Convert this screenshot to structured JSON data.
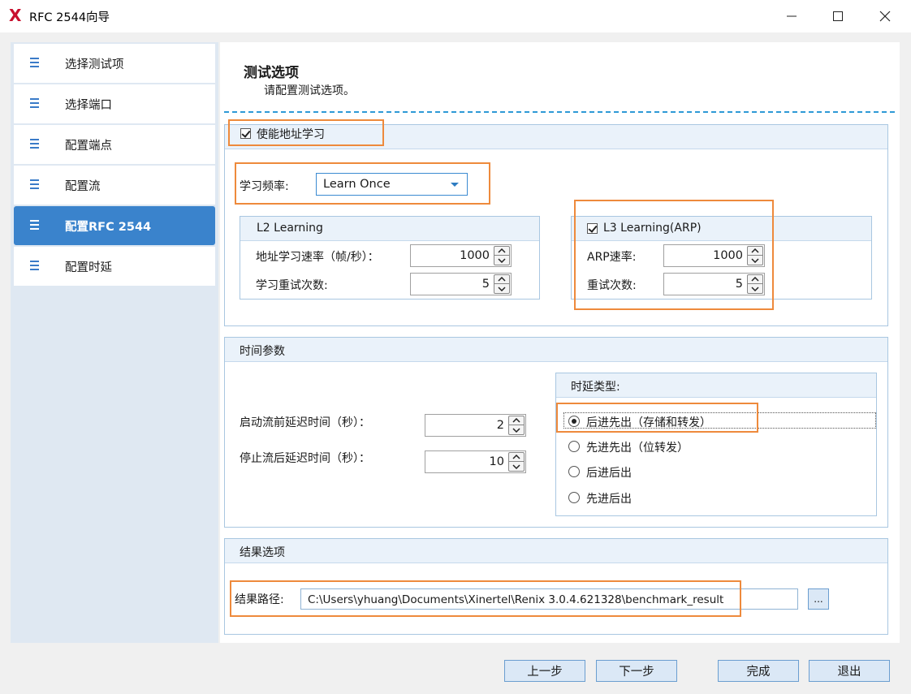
{
  "window": {
    "logo_letter": "X",
    "title": "RFC 2544向导"
  },
  "sidebar": {
    "items": [
      {
        "label": "选择测试项"
      },
      {
        "label": "选择端口"
      },
      {
        "label": "配置端点"
      },
      {
        "label": "配置流"
      },
      {
        "label": "配置RFC 2544",
        "active": true
      },
      {
        "label": "配置时延"
      }
    ]
  },
  "header": {
    "title": "测试选项",
    "subtitle": "请配置测试选项。"
  },
  "address_learning": {
    "enable_label": "使能地址学习",
    "enabled": true,
    "frequency_label": "学习频率:",
    "frequency_value": "Learn Once",
    "l2": {
      "title": "L2 Learning",
      "rate_label": "地址学习速率（帧/秒）：",
      "rate_value": "1000",
      "retry_label": "学习重试次数:",
      "retry_value": "5"
    },
    "l3": {
      "title": "L3 Learning(ARP)",
      "enabled": true,
      "rate_label": "ARP速率:",
      "rate_value": "1000",
      "retry_label": "重试次数:",
      "retry_value": "5"
    }
  },
  "time_params": {
    "title": "时间参数",
    "start_delay_label": "启动流前延迟时间（秒）：",
    "start_delay_value": "2",
    "stop_delay_label": "停止流后延迟时间（秒）：",
    "stop_delay_value": "10",
    "latency_type": {
      "title": "时延类型:",
      "options": [
        {
          "label": "后进先出（存储和转发）",
          "selected": true
        },
        {
          "label": "先进先出（位转发）",
          "selected": false
        },
        {
          "label": "后进后出",
          "selected": false
        },
        {
          "label": "先进后出",
          "selected": false
        }
      ]
    }
  },
  "result_options": {
    "title": "结果选项",
    "path_label": "结果路径:",
    "path_value": "C:\\Users\\yhuang\\Documents\\Xinertel\\Renix 3.0.4.621328\\benchmark_result",
    "browse_label": "..."
  },
  "footer": {
    "prev_label": "上一步",
    "next_label": "下一步",
    "finish_label": "完成",
    "exit_label": "退出"
  },
  "colors": {
    "accent": "#3a83cc",
    "highlight": "#ee8a3c",
    "logo": "#c8102e"
  }
}
